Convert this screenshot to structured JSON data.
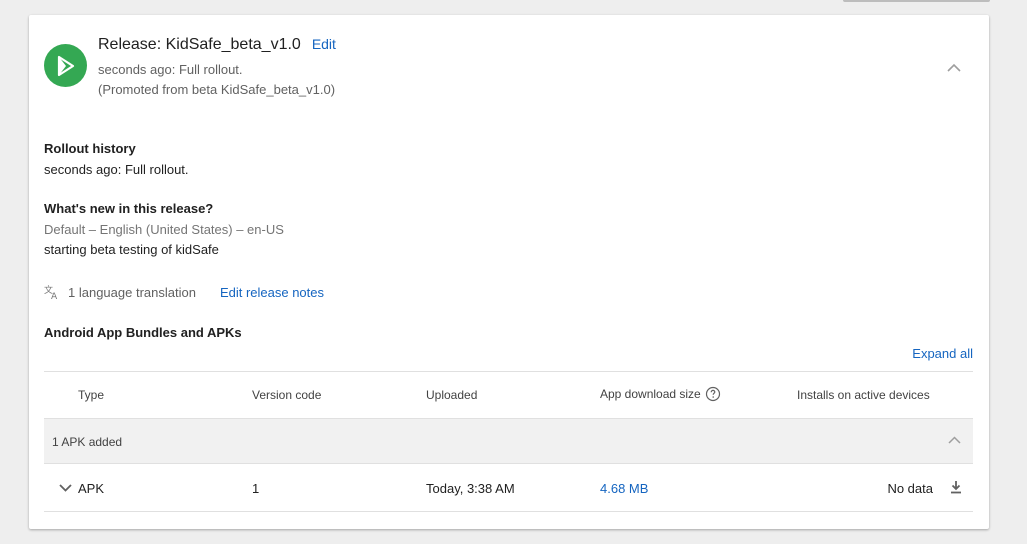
{
  "release": {
    "title": "Release: KidSafe_beta_v1.0",
    "edit_label": "Edit",
    "status": "seconds ago: Full rollout.",
    "promoted": "(Promoted from beta KidSafe_beta_v1.0)"
  },
  "rollout_history": {
    "heading": "Rollout history",
    "entry": "seconds ago: Full rollout."
  },
  "whats_new": {
    "heading": "What's new in this release?",
    "locale": "Default – English (United States) – en-US",
    "notes": "starting beta testing of kidSafe"
  },
  "translations": {
    "label": "1 language translation",
    "edit_notes_label": "Edit release notes"
  },
  "bundles": {
    "heading": "Android App Bundles and APKs",
    "expand_all_label": "Expand all",
    "columns": [
      "Type",
      "Version code",
      "Uploaded",
      "App download size",
      "Installs on active devices"
    ],
    "group_label": "1 APK added",
    "rows": [
      {
        "type": "APK",
        "version_code": "1",
        "uploaded": "Today, 3:38 AM",
        "size": "4.68 MB",
        "installs": "No data"
      }
    ]
  },
  "icons": {
    "logo": "play-console-logo-icon",
    "collapse": "chevron-up-icon",
    "translate": "translate-icon",
    "help": "help-circle-icon",
    "expand_row": "chevron-down-icon",
    "download": "download-icon"
  },
  "colors": {
    "accent": "#1565c0",
    "logo_bg": "#34a853"
  }
}
